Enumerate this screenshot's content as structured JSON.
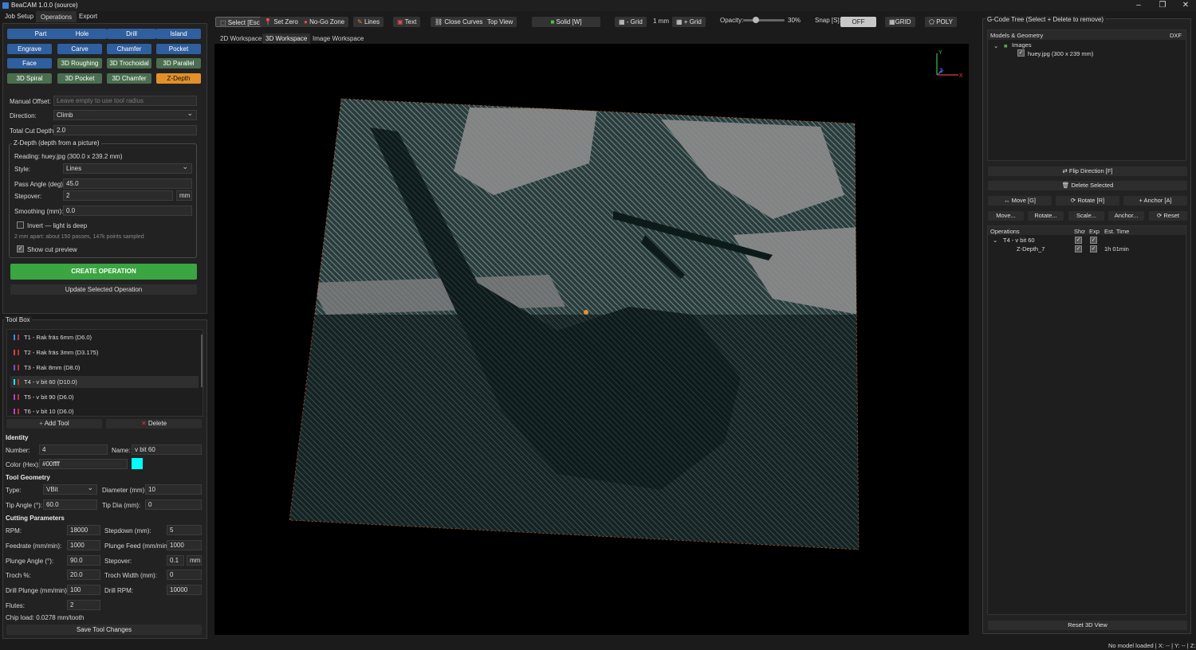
{
  "app": {
    "title": "BeaCAM 1.0.0 (source)",
    "window_controls": [
      "–",
      "❐",
      "✕"
    ]
  },
  "menu": {
    "items": [
      "Job Setup",
      "Operations",
      "Export"
    ],
    "active": "Operations"
  },
  "ops": {
    "row1": [
      "Part",
      "Hole",
      "Drill",
      "Island"
    ],
    "row2": [
      "Engrave",
      "Carve",
      "Chamfer",
      "Pocket"
    ],
    "row3": [
      "Face",
      "3D Roughing",
      "3D Trochoidal",
      "3D Parallel"
    ],
    "row4": [
      "3D Spiral",
      "3D Pocket",
      "3D Chamfer",
      "Z-Depth"
    ]
  },
  "params": {
    "manual_offset_label": "Manual Offset:",
    "manual_offset_placeholder": "Leave empty to use tool radius",
    "direction_label": "Direction:",
    "direction_value": "Climb",
    "total_depth_label": "Total Cut Depth:",
    "total_depth_value": "2.0"
  },
  "zdepth": {
    "group_title": "Z-Depth (depth from a picture)",
    "reading": "Reading: huey.jpg  (300.0 x 239.2 mm)",
    "style_label": "Style:",
    "style_value": "Lines",
    "pass_angle_label": "Pass Angle (deg):",
    "pass_angle_value": "45.0",
    "stepover_label": "Stepover:",
    "stepover_value": "2",
    "stepover_unit": "mm",
    "smoothing_label": "Smoothing (mm):",
    "smoothing_value": "0.0",
    "invert_label": "Invert — light is deep",
    "info": "2 mm apart: about 150 passes, 147k points sampled",
    "preview_label": "Show cut preview",
    "create": "CREATE OPERATION",
    "update": "Update Selected Operation"
  },
  "toolbox": {
    "title": "Tool Box",
    "tools": [
      {
        "label": "T1 - Rak fräs 6mm (D6.0)",
        "color": "#3a8de0"
      },
      {
        "label": "T2 - Rak fräs 3mm (D3.175)",
        "color": "#e04040"
      },
      {
        "label": "T3 - Rak 8mm (D8.0)",
        "color": "#7a4fd0"
      },
      {
        "label": "T4 - v bit 60 (D10.0)",
        "color": "#00ffff"
      },
      {
        "label": "T5 - v bit 90 (D6.0)",
        "color": "#b040d0"
      },
      {
        "label": "T6 - v bit 10 (D6.0)",
        "color": "#c040c0"
      }
    ],
    "add": "Add Tool",
    "delete": "Delete"
  },
  "identity": {
    "title": "Identity",
    "number_label": "Number:",
    "number_value": "4",
    "name_label": "Name:",
    "name_value": "v bit 60",
    "color_label": "Color (Hex):",
    "color_value": "#00ffff",
    "swatch": "#00ffff"
  },
  "geometry": {
    "title": "Tool Geometry",
    "type_label": "Type:",
    "type_value": "VBit",
    "diameter_label": "Diameter (mm):",
    "diameter_value": "10",
    "tip_angle_label": "Tip Angle (°):",
    "tip_angle_value": "60.0",
    "tip_dia_label": "Tip Dia (mm):",
    "tip_dia_value": "0"
  },
  "cutting": {
    "title": "Cutting Parameters",
    "rpm_label": "RPM:",
    "rpm_value": "18000",
    "stepdown_label": "Stepdown (mm):",
    "stepdown_value": "5",
    "feed_label": "Feedrate (mm/min):",
    "feed_value": "1000",
    "plunge_feed_label": "Plunge Feed (mm/min):",
    "plunge_feed_value": "1000",
    "plunge_angle_label": "Plunge Angle (°):",
    "plunge_angle_value": "90.0",
    "stepover_label": "Stepover:",
    "stepover_value": "0.1",
    "stepover_unit": "mm",
    "troch_label": "Troch %:",
    "troch_value": "20.0",
    "troch_width_label": "Troch Width (mm):",
    "troch_width_value": "0",
    "drill_plunge_label": "Drill Plunge (mm/min):",
    "drill_plunge_value": "100",
    "drill_rpm_label": "Drill RPM:",
    "drill_rpm_value": "10000",
    "flutes_label": "Flutes:",
    "flutes_value": "2",
    "chip_load": "Chip load: 0.0278 mm/tooth",
    "save": "Save Tool Changes"
  },
  "toolbar": {
    "select": "Select [Esc]",
    "set_zero": "Set Zero",
    "no_go": "No-Go Zone",
    "lines": "Lines",
    "text": "Text",
    "close_curves": "Close Curves",
    "top_view": "Top View",
    "solid": "Solid [W]",
    "minus_grid": "- Grid",
    "grid_size": "1 mm",
    "plus_grid": "+ Grid",
    "opacity_label": "Opacity:",
    "opacity_value": "30%",
    "opacity_fraction": 0.3,
    "snap_label": "Snap [S]:",
    "snap_value": "OFF",
    "grid_btn": "GRID",
    "poly_btn": "POLY"
  },
  "workspace_tabs": {
    "items": [
      "2D Workspace",
      "3D Workspace",
      "Image Workspace"
    ],
    "active": "3D Workspace"
  },
  "axes": {
    "y": "Y",
    "z": "Z",
    "x": "X"
  },
  "gcode": {
    "title": "G-Code Tree (Select + Delete to remove)",
    "models_header": "Models & Geometry",
    "dxf": "DXF",
    "images": "Images",
    "image_file": "huey.jpg  (300 x 239 mm)",
    "flip": "Flip Direction [F]",
    "delete_selected": "Delete Selected",
    "move_g": "Move [G]",
    "rotate_r": "Rotate [R]",
    "anchor_a": "Anchor [A]",
    "move": "Move...",
    "rotate": "Rotate...",
    "scale": "Scale...",
    "anchor": "Anchor...",
    "reset": "Reset",
    "col_ops": "Operations",
    "col_show": "Show",
    "col_exp": "Exp",
    "col_time": "Est. Time",
    "op_parent": "T4 - v bit 60",
    "op_child": "Z-Depth_7",
    "op_time": "1h 01min",
    "reset_view": "Reset 3D View"
  },
  "status": {
    "text": "No model loaded  |  X: -- | Y: -- | Z: --"
  }
}
